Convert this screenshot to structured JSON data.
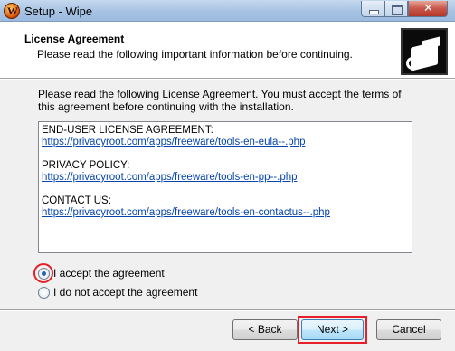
{
  "window": {
    "title": "Setup - Wipe"
  },
  "header": {
    "title": "License Agreement",
    "subtitle": "Please read the following important information before continuing."
  },
  "body": {
    "intro": "Please read the following License Agreement. You must accept the terms of this agreement before continuing with the installation.",
    "license": {
      "eula_label": "END-USER LICENSE AGREEMENT:",
      "eula_link": "https://privacyroot.com/apps/freeware/tools-en-eula--.php",
      "privacy_label": "PRIVACY POLICY:",
      "privacy_link": "https://privacyroot.com/apps/freeware/tools-en-pp--.php",
      "contact_label": "CONTACT US:",
      "contact_link": "https://privacyroot.com/apps/freeware/tools-en-contactus--.php"
    },
    "options": {
      "accept": "I accept the agreement",
      "decline": "I do not accept the agreement",
      "selected": "accept"
    }
  },
  "footer": {
    "back": "< Back",
    "next": "Next >",
    "cancel": "Cancel"
  },
  "colors": {
    "highlight": "#e5202a",
    "link": "#0645ad"
  }
}
